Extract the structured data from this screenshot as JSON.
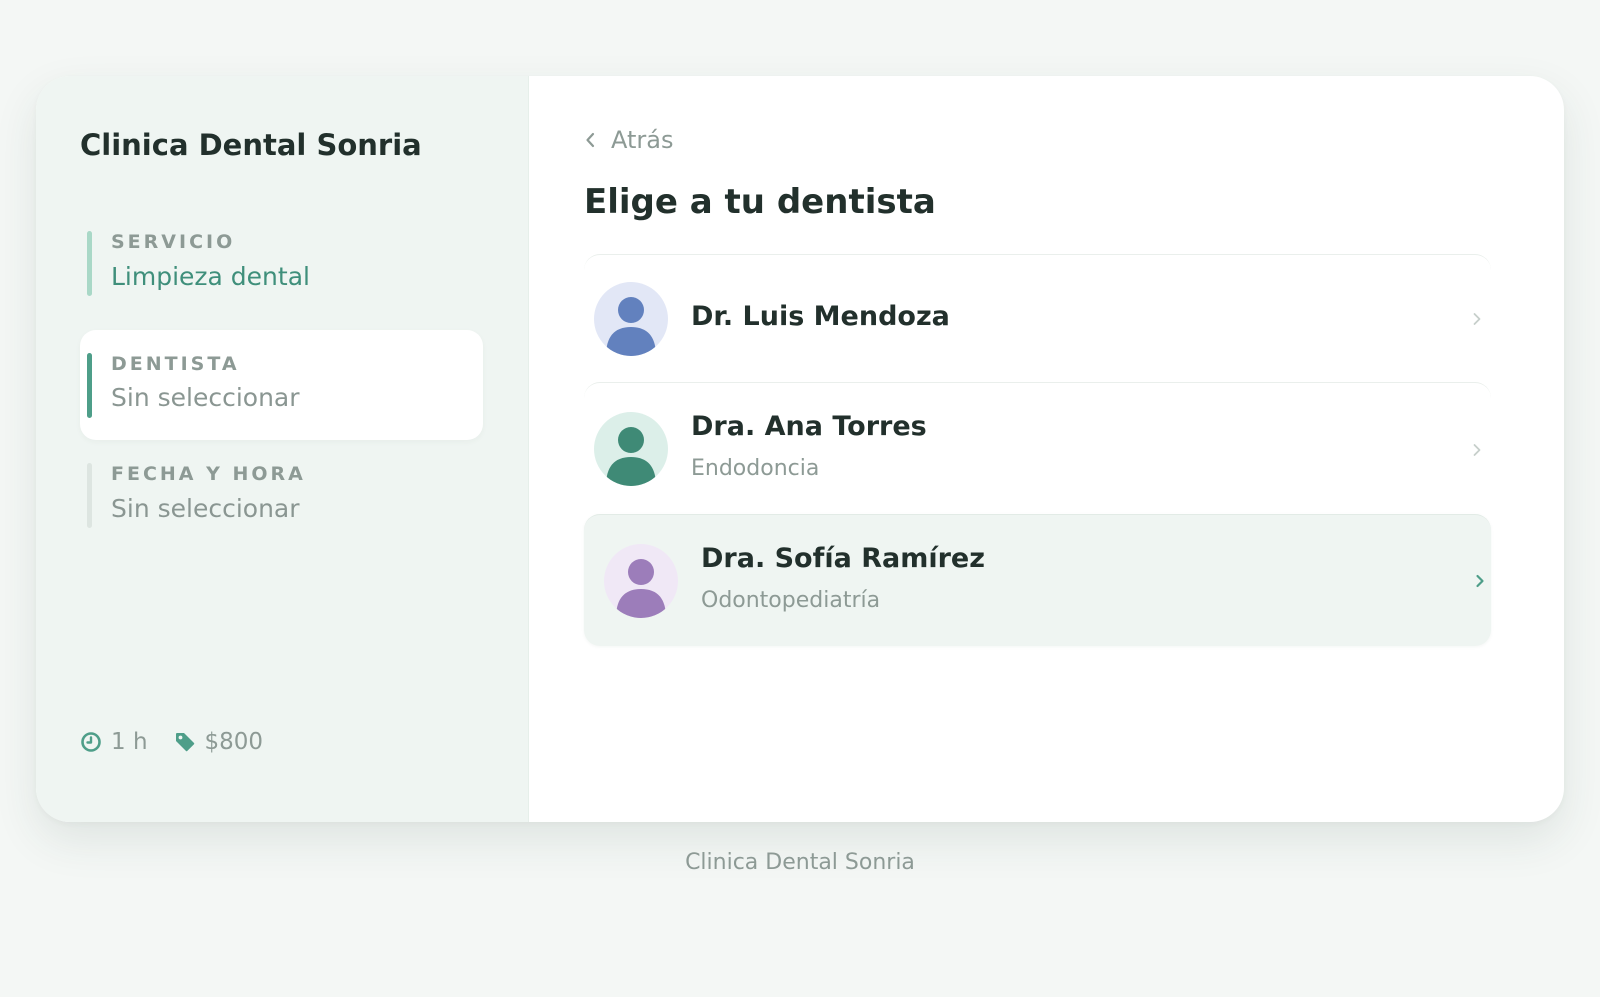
{
  "sidebar": {
    "brand": "Clinica Dental Sonria",
    "steps": [
      {
        "label": "SERVICIO",
        "value": "Limpieza dental",
        "state": "completed"
      },
      {
        "label": "DENTISTA",
        "value": "Sin seleccionar",
        "state": "active"
      },
      {
        "label": "FECHA Y HORA",
        "value": "Sin seleccionar",
        "state": "pending"
      }
    ],
    "meta": {
      "duration": "1 h",
      "price": "$800",
      "duration_icon": "clock-icon",
      "price_icon": "tag-icon"
    }
  },
  "main": {
    "back_label": "Atrás",
    "back_icon": "chevron-left-icon",
    "title": "Elige a tu dentista",
    "dentists": [
      {
        "name": "Dr. Luis Mendoza",
        "specialty": "",
        "avatar_bg": "#e2e7f6",
        "avatar_fg": "#6281be"
      },
      {
        "name": "Dra. Ana Torres",
        "specialty": "Endodoncia",
        "avatar_bg": "#dcefe9",
        "avatar_fg": "#3f8a76"
      },
      {
        "name": "Dra. Sofía Ramírez",
        "specialty": "Odontopediatría",
        "avatar_bg": "#f0e8f6",
        "avatar_fg": "#9c7dba",
        "hovered": true
      }
    ]
  },
  "footer": "Clinica Dental Sonria",
  "colors": {
    "accent": "#4e9e89",
    "accent_light": "#a9d8c7",
    "page_bg": "#f4f7f5",
    "sidebar_bg": "#eff5f2",
    "text_dark": "#22302c",
    "text_muted": "#8d9a95"
  }
}
